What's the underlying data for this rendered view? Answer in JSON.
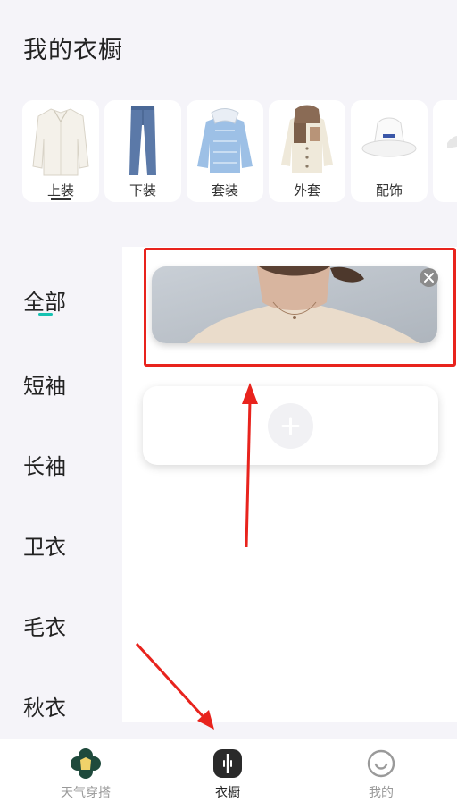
{
  "header": {
    "title": "我的衣橱"
  },
  "categories": [
    {
      "label": "上装",
      "icon": "white-shirt-icon"
    },
    {
      "label": "下装",
      "icon": "jeans-icon"
    },
    {
      "label": "套装",
      "icon": "striped-shirt-set-icon"
    },
    {
      "label": "外套",
      "icon": "hoodie-jacket-icon"
    },
    {
      "label": "配饰",
      "icon": "bucket-hat-icon"
    },
    {
      "label": "",
      "icon": "shoe-icon"
    }
  ],
  "sidebar": {
    "items": [
      {
        "label": "全部"
      },
      {
        "label": "短袖"
      },
      {
        "label": "长袖"
      },
      {
        "label": "卫衣"
      },
      {
        "label": "毛衣"
      },
      {
        "label": "秋衣"
      }
    ]
  },
  "main": {
    "photo_item": {
      "alt": "neck-shoulder-photo"
    },
    "add_button_glyph": "+"
  },
  "tabbar": {
    "tabs": [
      {
        "label": "天气穿搭",
        "icon": "weather-clover-icon"
      },
      {
        "label": "衣橱",
        "icon": "wardrobe-icon"
      },
      {
        "label": "我的",
        "icon": "smiley-profile-icon"
      }
    ]
  },
  "colors": {
    "accent": "#16c2b2",
    "annotation": "#e8231d",
    "background": "#f5f4f9"
  }
}
